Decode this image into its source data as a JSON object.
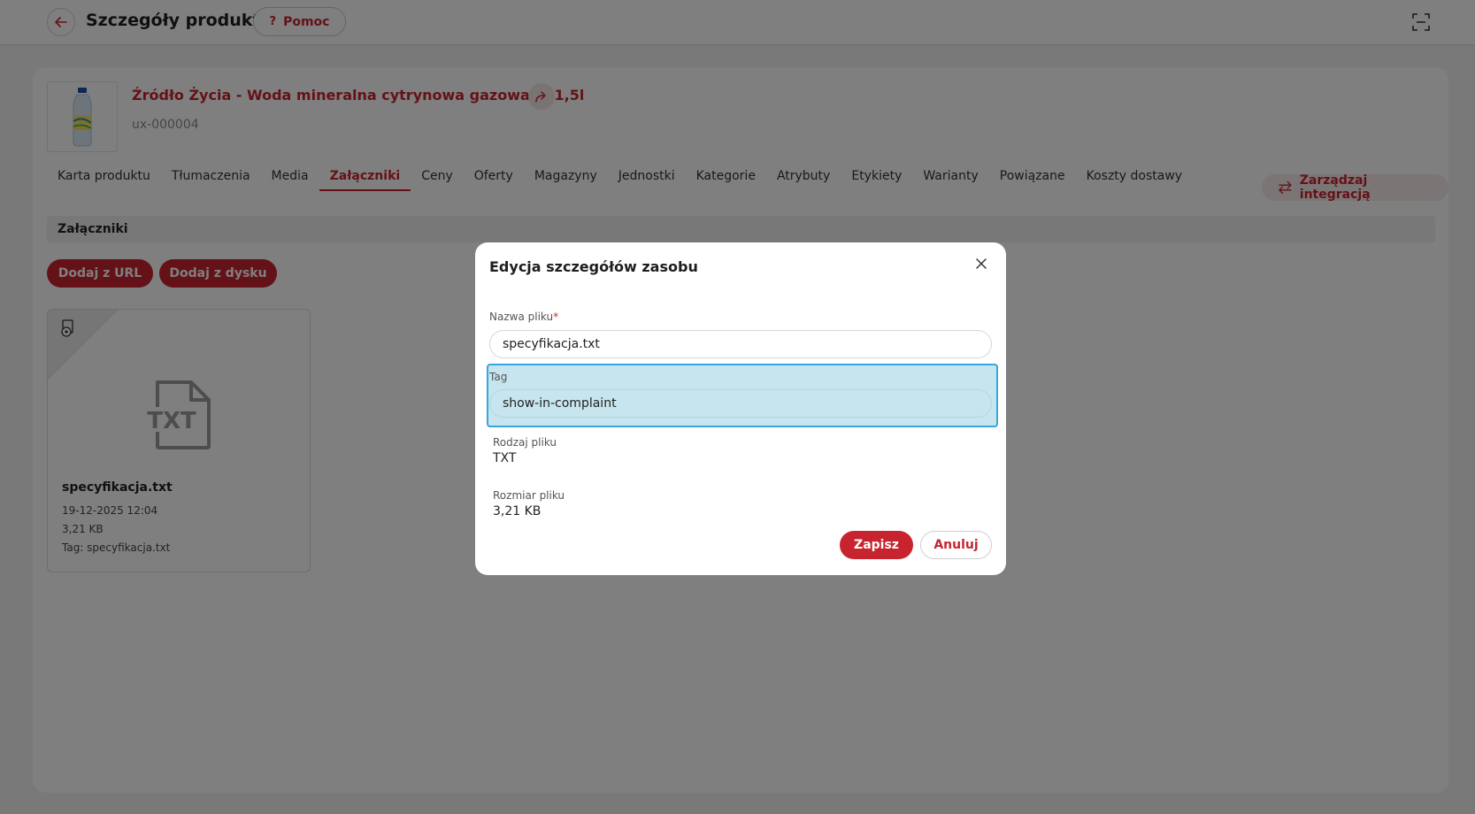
{
  "header": {
    "title": "Szczegóły produktu",
    "help_label": "Pomoc",
    "help_glyph": "?"
  },
  "product": {
    "name": "Źródło Życia - Woda mineralna cytrynowa gazowana 1,5l",
    "sku": "ux-000004"
  },
  "tabs": [
    {
      "label": "Karta produktu",
      "active": false
    },
    {
      "label": "Tłumaczenia",
      "active": false
    },
    {
      "label": "Media",
      "active": false
    },
    {
      "label": "Załączniki",
      "active": true
    },
    {
      "label": "Ceny",
      "active": false
    },
    {
      "label": "Oferty",
      "active": false
    },
    {
      "label": "Magazyny",
      "active": false
    },
    {
      "label": "Jednostki",
      "active": false
    },
    {
      "label": "Kategorie",
      "active": false
    },
    {
      "label": "Atrybuty",
      "active": false
    },
    {
      "label": "Etykiety",
      "active": false
    },
    {
      "label": "Warianty",
      "active": false
    },
    {
      "label": "Powiązane",
      "active": false
    },
    {
      "label": "Koszty dostawy",
      "active": false
    }
  ],
  "integration_label": "Zarządzaj integracją",
  "section": {
    "title": "Załączniki",
    "add_url_label": "Dodaj z URL",
    "add_disk_label": "Dodaj z dysku"
  },
  "file_card": {
    "name": "specyfikacja.txt",
    "date": "19-12-2025 12:04",
    "size": "3,21 KB",
    "tag": "Tag: specyfikacja.txt",
    "icon_text": "TXT"
  },
  "modal": {
    "title": "Edycja szczegółów zasobu",
    "filename_label": "Nazwa pliku",
    "required_mark": "*",
    "filename_value": "specyfikacja.txt",
    "tag_label": "Tag",
    "tag_value": "show-in-complaint",
    "type_label": "Rodzaj pliku",
    "type_value": "TXT",
    "size_label": "Rozmiar pliku",
    "size_value": "3,21 KB",
    "save_label": "Zapisz",
    "cancel_label": "Anuluj"
  },
  "colors": {
    "accent": "#c8242f",
    "focus": "#35a7dc",
    "focus_fill": "#c7e5ee"
  }
}
